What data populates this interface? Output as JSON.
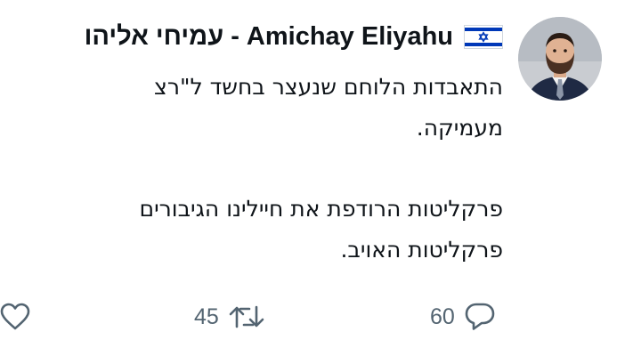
{
  "tweet": {
    "author": {
      "display_name": "עמיחי אליהו - Amichay Eliyahu",
      "flag_icon": "israel-flag-icon",
      "avatar": "profile-photo"
    },
    "text_lines": [
      "התאבדות הלוחם שנעצר בחשד ל\"רצ",
      "מעמיקה.",
      "פרקליטות הרודפת את חיילינו הגיבורים",
      "פרקליטות האויב."
    ],
    "actions": {
      "like_icon": "heart-icon",
      "retweet_count": "45",
      "retweet_icon": "retweet-icon",
      "reply_count": "60",
      "reply_icon": "reply-icon"
    }
  },
  "colors": {
    "text": "#0f1419",
    "secondary": "#536471",
    "flag_blue": "#0038b8"
  }
}
